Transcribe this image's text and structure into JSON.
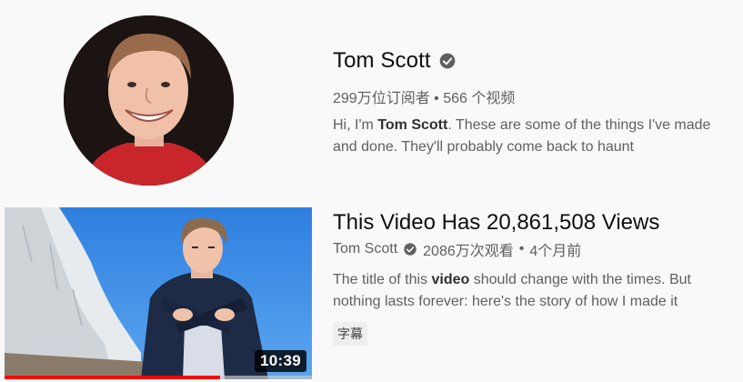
{
  "channel": {
    "name": "Tom Scott",
    "subscribers": "299万位订阅者",
    "separator": "•",
    "video_count": "566 个视频",
    "description": {
      "prefix": "Hi, I'm ",
      "bold": "Tom Scott",
      "suffix": ". These are some of the things I've made and done. They'll probably come back to haunt"
    },
    "verified_icon": "verified-check-icon"
  },
  "video": {
    "title": "This Video Has 20,861,508 Views",
    "channel_name": "Tom Scott",
    "views": "2086万次观看",
    "separator": "•",
    "age": "4个月前",
    "description": {
      "prefix": "The title of this ",
      "bold": "video",
      "suffix": " should change with the times. But nothing lasts forever: here's the story of how I made it"
    },
    "badge": "字幕",
    "duration": "10:39",
    "watched_fraction": 0.7,
    "progress_color": "#ff0000"
  }
}
